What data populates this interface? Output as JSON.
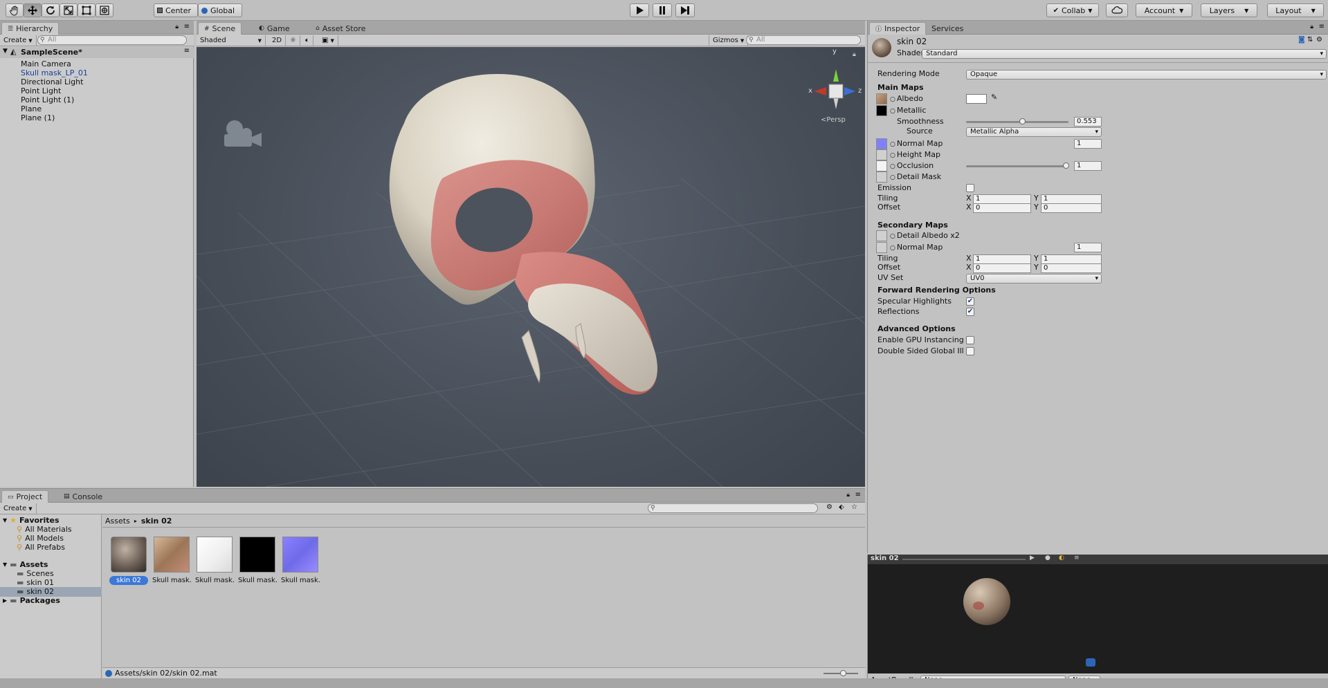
{
  "toolbar": {
    "tools": [
      {
        "name": "hand-tool",
        "icon": "hand-icon"
      },
      {
        "name": "move-tool",
        "icon": "move-icon"
      },
      {
        "name": "rotate-tool",
        "icon": "rotate-icon"
      },
      {
        "name": "scale-tool",
        "icon": "scale-icon"
      },
      {
        "name": "rect-tool",
        "icon": "rect-icon"
      },
      {
        "name": "transform-tool",
        "icon": "transform-icon"
      }
    ],
    "pivot_label": "Center",
    "space_label": "Global",
    "play_icon": "play-icon",
    "pause_icon": "pause-icon",
    "step_icon": "step-icon",
    "collab_label": "Collab",
    "account_label": "Account",
    "layers_label": "Layers",
    "layout_label": "Layout"
  },
  "hierarchy": {
    "tab_label": "Hierarchy",
    "create_label": "Create",
    "search_placeholder": "All",
    "scene_name": "SampleScene*",
    "items": [
      {
        "label": "Main Camera",
        "color": "#111111"
      },
      {
        "label": "Skull mask_LP_01",
        "color": "#1a3e9a"
      },
      {
        "label": "Directional Light",
        "color": "#111111"
      },
      {
        "label": "Point Light",
        "color": "#111111"
      },
      {
        "label": "Point Light (1)",
        "color": "#111111"
      },
      {
        "label": "Plane",
        "color": "#111111"
      },
      {
        "label": "Plane (1)",
        "color": "#111111"
      }
    ]
  },
  "scene": {
    "tabs": [
      "Scene",
      "Game",
      "Asset Store"
    ],
    "shading_mode": "Shaded",
    "mode_2d": "2D",
    "gizmos_label": "Gizmos",
    "search_placeholder": "All",
    "axis_x": "x",
    "axis_y": "y",
    "axis_z": "z",
    "persp_label": "Persp"
  },
  "inspector": {
    "tabs": [
      "Inspector",
      "Services"
    ],
    "material_name": "skin 02",
    "shader_label": "Shader",
    "shader_value": "Standard",
    "rendering_mode_label": "Rendering Mode",
    "rendering_mode_value": "Opaque",
    "main_maps_header": "Main Maps",
    "albedo_label": "Albedo",
    "metallic_label": "Metallic",
    "smoothness_label": "Smoothness",
    "smoothness_value": "0.553",
    "smoothness_fraction": 0.553,
    "source_label": "Source",
    "source_value": "Metallic Alpha",
    "normal_map_label": "Normal Map",
    "normal_map_value": "1",
    "height_map_label": "Height Map",
    "occlusion_label": "Occlusion",
    "occlusion_value": "1",
    "occlusion_fraction": 1.0,
    "detail_mask_label": "Detail Mask",
    "emission_label": "Emission",
    "tiling_label": "Tiling",
    "offset_label": "Offset",
    "x_label": "X",
    "y_label": "Y",
    "tiling_x": "1",
    "tiling_y": "1",
    "offset_x": "0",
    "offset_y": "0",
    "secondary_maps_header": "Secondary Maps",
    "detail_albedo_label": "Detail Albedo x2",
    "sec_normal_map_label": "Normal Map",
    "sec_normal_map_value": "1",
    "sec_tiling_x": "1",
    "sec_tiling_y": "1",
    "sec_offset_x": "0",
    "sec_offset_y": "0",
    "uv_set_label": "UV Set",
    "uv_set_value": "UV0",
    "forward_header": "Forward Rendering Options",
    "specular_label": "Specular Highlights",
    "reflections_label": "Reflections",
    "advanced_header": "Advanced Options",
    "gpu_instancing_label": "Enable GPU Instancing",
    "double_sided_label": "Double Sided Global Ill",
    "albedo_color": "#ffffff",
    "metallic_color": "#000000",
    "normal_color": "#8080ff"
  },
  "preview": {
    "title": "skin 02",
    "assetbundle_label": "AssetBundle",
    "assetbundle_value": "None",
    "variant_value": "None"
  },
  "project": {
    "tabs": [
      "Project",
      "Console"
    ],
    "create_label": "Create",
    "favorites_label": "Favorites",
    "favorites": [
      "All Materials",
      "All Models",
      "All Prefabs"
    ],
    "assets_label": "Assets",
    "folders": [
      "Scenes",
      "skin 01",
      "skin 02"
    ],
    "packages_label": "Packages",
    "breadcrumb_root": "Assets",
    "breadcrumb_current": "skin 02",
    "items": [
      {
        "label": "skin 02",
        "kind": "material-sphere"
      },
      {
        "label": "Skull mask...",
        "kind": "albedo-texture"
      },
      {
        "label": "Skull mask...",
        "kind": "white-texture"
      },
      {
        "label": "Skull mask...",
        "kind": "black-texture"
      },
      {
        "label": "Skull mask...",
        "kind": "normal-texture"
      }
    ],
    "status_path": "Assets/skin 02/skin 02.mat"
  }
}
